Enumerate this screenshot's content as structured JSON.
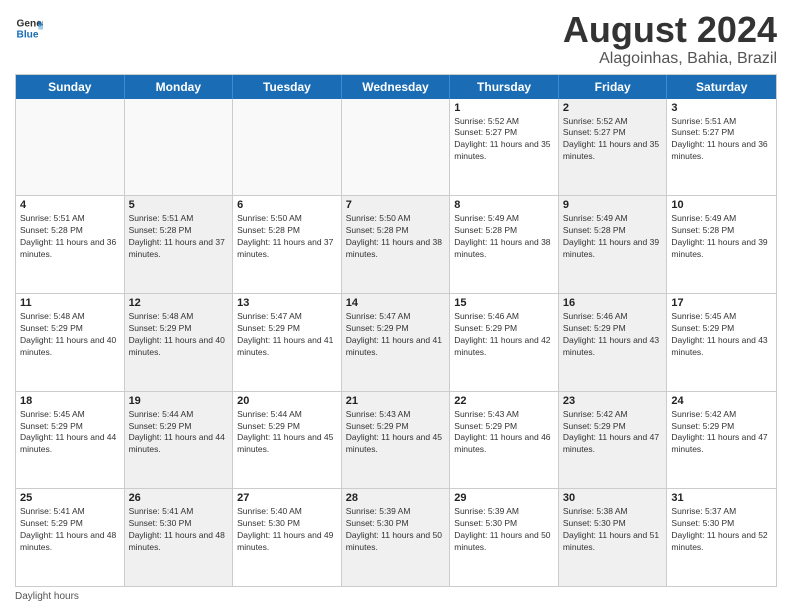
{
  "logo": {
    "line1": "General",
    "line2": "Blue"
  },
  "title": "August 2024",
  "subtitle": "Alagoinhas, Bahia, Brazil",
  "weekdays": [
    "Sunday",
    "Monday",
    "Tuesday",
    "Wednesday",
    "Thursday",
    "Friday",
    "Saturday"
  ],
  "weeks": [
    [
      {
        "day": "",
        "info": "",
        "shaded": false,
        "empty": true
      },
      {
        "day": "",
        "info": "",
        "shaded": false,
        "empty": true
      },
      {
        "day": "",
        "info": "",
        "shaded": false,
        "empty": true
      },
      {
        "day": "",
        "info": "",
        "shaded": false,
        "empty": true
      },
      {
        "day": "1",
        "info": "Sunrise: 5:52 AM\nSunset: 5:27 PM\nDaylight: 11 hours and 35 minutes.",
        "shaded": false,
        "empty": false
      },
      {
        "day": "2",
        "info": "Sunrise: 5:52 AM\nSunset: 5:27 PM\nDaylight: 11 hours and 35 minutes.",
        "shaded": true,
        "empty": false
      },
      {
        "day": "3",
        "info": "Sunrise: 5:51 AM\nSunset: 5:27 PM\nDaylight: 11 hours and 36 minutes.",
        "shaded": false,
        "empty": false
      }
    ],
    [
      {
        "day": "4",
        "info": "Sunrise: 5:51 AM\nSunset: 5:28 PM\nDaylight: 11 hours and 36 minutes.",
        "shaded": false,
        "empty": false
      },
      {
        "day": "5",
        "info": "Sunrise: 5:51 AM\nSunset: 5:28 PM\nDaylight: 11 hours and 37 minutes.",
        "shaded": true,
        "empty": false
      },
      {
        "day": "6",
        "info": "Sunrise: 5:50 AM\nSunset: 5:28 PM\nDaylight: 11 hours and 37 minutes.",
        "shaded": false,
        "empty": false
      },
      {
        "day": "7",
        "info": "Sunrise: 5:50 AM\nSunset: 5:28 PM\nDaylight: 11 hours and 38 minutes.",
        "shaded": true,
        "empty": false
      },
      {
        "day": "8",
        "info": "Sunrise: 5:49 AM\nSunset: 5:28 PM\nDaylight: 11 hours and 38 minutes.",
        "shaded": false,
        "empty": false
      },
      {
        "day": "9",
        "info": "Sunrise: 5:49 AM\nSunset: 5:28 PM\nDaylight: 11 hours and 39 minutes.",
        "shaded": true,
        "empty": false
      },
      {
        "day": "10",
        "info": "Sunrise: 5:49 AM\nSunset: 5:28 PM\nDaylight: 11 hours and 39 minutes.",
        "shaded": false,
        "empty": false
      }
    ],
    [
      {
        "day": "11",
        "info": "Sunrise: 5:48 AM\nSunset: 5:29 PM\nDaylight: 11 hours and 40 minutes.",
        "shaded": false,
        "empty": false
      },
      {
        "day": "12",
        "info": "Sunrise: 5:48 AM\nSunset: 5:29 PM\nDaylight: 11 hours and 40 minutes.",
        "shaded": true,
        "empty": false
      },
      {
        "day": "13",
        "info": "Sunrise: 5:47 AM\nSunset: 5:29 PM\nDaylight: 11 hours and 41 minutes.",
        "shaded": false,
        "empty": false
      },
      {
        "day": "14",
        "info": "Sunrise: 5:47 AM\nSunset: 5:29 PM\nDaylight: 11 hours and 41 minutes.",
        "shaded": true,
        "empty": false
      },
      {
        "day": "15",
        "info": "Sunrise: 5:46 AM\nSunset: 5:29 PM\nDaylight: 11 hours and 42 minutes.",
        "shaded": false,
        "empty": false
      },
      {
        "day": "16",
        "info": "Sunrise: 5:46 AM\nSunset: 5:29 PM\nDaylight: 11 hours and 43 minutes.",
        "shaded": true,
        "empty": false
      },
      {
        "day": "17",
        "info": "Sunrise: 5:45 AM\nSunset: 5:29 PM\nDaylight: 11 hours and 43 minutes.",
        "shaded": false,
        "empty": false
      }
    ],
    [
      {
        "day": "18",
        "info": "Sunrise: 5:45 AM\nSunset: 5:29 PM\nDaylight: 11 hours and 44 minutes.",
        "shaded": false,
        "empty": false
      },
      {
        "day": "19",
        "info": "Sunrise: 5:44 AM\nSunset: 5:29 PM\nDaylight: 11 hours and 44 minutes.",
        "shaded": true,
        "empty": false
      },
      {
        "day": "20",
        "info": "Sunrise: 5:44 AM\nSunset: 5:29 PM\nDaylight: 11 hours and 45 minutes.",
        "shaded": false,
        "empty": false
      },
      {
        "day": "21",
        "info": "Sunrise: 5:43 AM\nSunset: 5:29 PM\nDaylight: 11 hours and 45 minutes.",
        "shaded": true,
        "empty": false
      },
      {
        "day": "22",
        "info": "Sunrise: 5:43 AM\nSunset: 5:29 PM\nDaylight: 11 hours and 46 minutes.",
        "shaded": false,
        "empty": false
      },
      {
        "day": "23",
        "info": "Sunrise: 5:42 AM\nSunset: 5:29 PM\nDaylight: 11 hours and 47 minutes.",
        "shaded": true,
        "empty": false
      },
      {
        "day": "24",
        "info": "Sunrise: 5:42 AM\nSunset: 5:29 PM\nDaylight: 11 hours and 47 minutes.",
        "shaded": false,
        "empty": false
      }
    ],
    [
      {
        "day": "25",
        "info": "Sunrise: 5:41 AM\nSunset: 5:29 PM\nDaylight: 11 hours and 48 minutes.",
        "shaded": false,
        "empty": false
      },
      {
        "day": "26",
        "info": "Sunrise: 5:41 AM\nSunset: 5:30 PM\nDaylight: 11 hours and 48 minutes.",
        "shaded": true,
        "empty": false
      },
      {
        "day": "27",
        "info": "Sunrise: 5:40 AM\nSunset: 5:30 PM\nDaylight: 11 hours and 49 minutes.",
        "shaded": false,
        "empty": false
      },
      {
        "day": "28",
        "info": "Sunrise: 5:39 AM\nSunset: 5:30 PM\nDaylight: 11 hours and 50 minutes.",
        "shaded": true,
        "empty": false
      },
      {
        "day": "29",
        "info": "Sunrise: 5:39 AM\nSunset: 5:30 PM\nDaylight: 11 hours and 50 minutes.",
        "shaded": false,
        "empty": false
      },
      {
        "day": "30",
        "info": "Sunrise: 5:38 AM\nSunset: 5:30 PM\nDaylight: 11 hours and 51 minutes.",
        "shaded": true,
        "empty": false
      },
      {
        "day": "31",
        "info": "Sunrise: 5:37 AM\nSunset: 5:30 PM\nDaylight: 11 hours and 52 minutes.",
        "shaded": false,
        "empty": false
      }
    ]
  ],
  "footer": "Daylight hours"
}
